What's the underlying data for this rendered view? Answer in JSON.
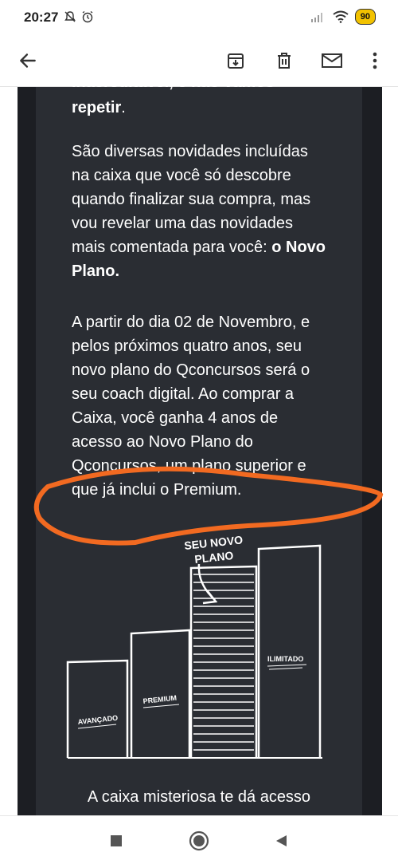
{
  "status_bar": {
    "time": "20:27",
    "battery": "90",
    "icons": [
      "mute-icon",
      "alarm-icon",
      "signal-icon",
      "wifi-icon",
      "battery-icon"
    ]
  },
  "app_bar": {
    "icons": [
      "back-arrow-icon",
      "archive-icon",
      "delete-icon",
      "mail-icon",
      "more-vert-icon"
    ]
  },
  "email": {
    "cut_line": "inacreditável, e não vamos",
    "p1_end": "repetir",
    "p1_period": ".",
    "p2_text": "São diversas novidades incluídas na caixa que você só descobre quando finalizar sua compra, mas vou revelar uma das novidades mais comentada para você: ",
    "p2_bold": "o Novo Plano.",
    "p3_text": "A partir do dia 02 de Novembro, e pelos próximos quatro anos, seu novo plano do Qconcursos será o seu coach digital. Ao comprar a Caixa, você ganha 4 anos de acesso ao Novo Plano do Qconcursos, um plano superior e que já inclui o Premium.",
    "bottom_line": "A caixa misteriosa te dá acesso"
  },
  "illustration": {
    "label_new_plan_1": "SEU NOVO",
    "label_new_plan_2": "PLANO",
    "bars": [
      "AVANÇADO",
      "PREMIUM",
      "ILIMITADO"
    ]
  },
  "nav_bar": {
    "icons": [
      "recents-square-icon",
      "home-circle-icon",
      "back-triangle-icon"
    ]
  },
  "colors": {
    "email_background": "#2a2d33",
    "email_outer": "#1c1e23",
    "annotation": "#f26a21",
    "battery": "#f2c200"
  }
}
